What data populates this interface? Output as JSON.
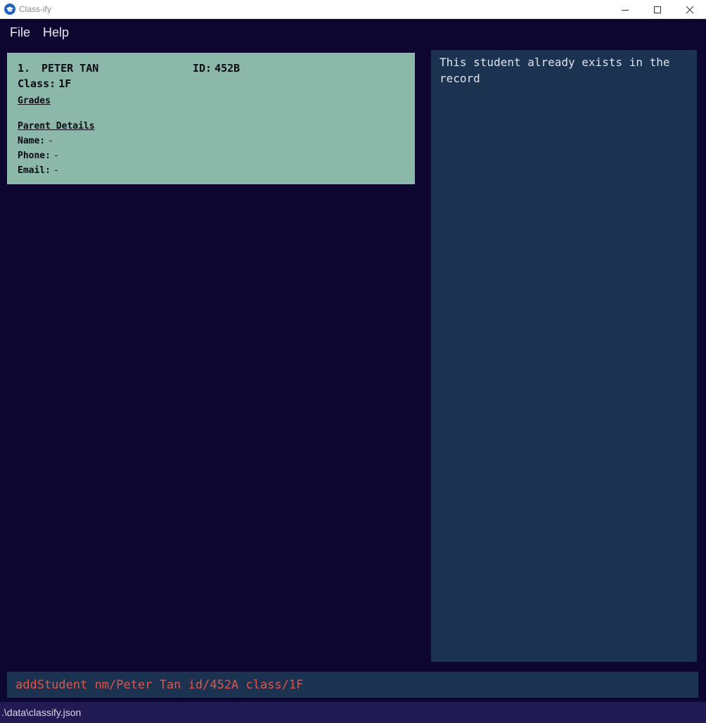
{
  "window": {
    "title": "Class-ify",
    "icon": "graduation-cap-icon",
    "controls": [
      "minimize-icon",
      "maximize-icon",
      "close-icon"
    ]
  },
  "menu": {
    "items": [
      {
        "label": "File"
      },
      {
        "label": "Help"
      }
    ]
  },
  "student_list": {
    "students": [
      {
        "index": "1.",
        "name": "PETER TAN",
        "id_label": "ID:",
        "id": "452B",
        "class_label": "Class:",
        "class": "1F",
        "grades_heading": "Grades",
        "parent_heading": "Parent Details",
        "parent_name_label": "Name:",
        "parent_name": "-",
        "parent_phone_label": "Phone:",
        "parent_phone": "-",
        "parent_email_label": "Email:",
        "parent_email": "-"
      }
    ]
  },
  "result_display": {
    "text": "This student already exists in the record"
  },
  "command_box": {
    "value": "addStudent nm/Peter Tan id/452A class/1F"
  },
  "status_bar": {
    "path": ".\\data\\classify.json"
  },
  "colors": {
    "background": "#0d0630",
    "card": "#8bb8a8",
    "panel": "#1b3250",
    "command_text_error": "#e0554a",
    "status_bar": "#221a52"
  }
}
